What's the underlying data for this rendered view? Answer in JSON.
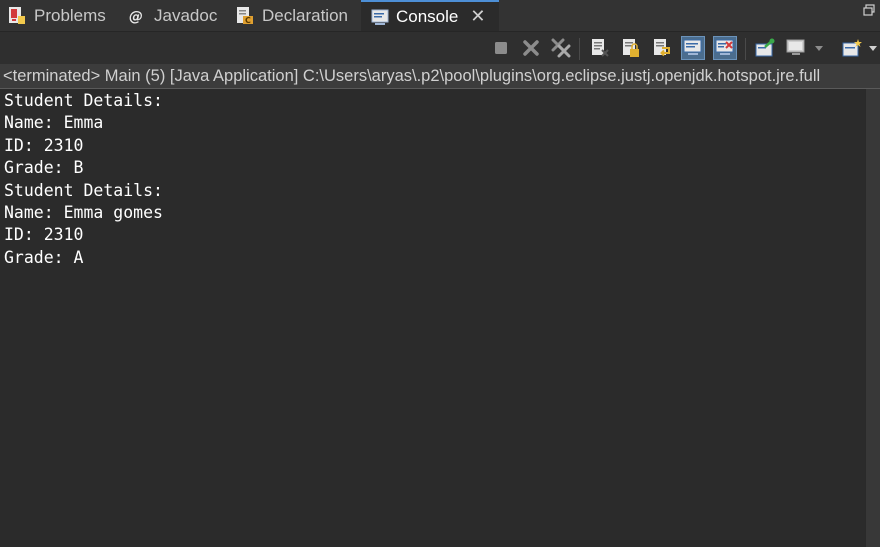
{
  "tabs": [
    {
      "label": "Problems",
      "icon": "problems-icon",
      "active": false
    },
    {
      "label": "Javadoc",
      "icon": "javadoc-icon",
      "active": false
    },
    {
      "label": "Declaration",
      "icon": "declaration-icon",
      "active": false
    },
    {
      "label": "Console",
      "icon": "console-icon",
      "active": true
    }
  ],
  "console": {
    "status_line": "<terminated> Main (5) [Java Application] C:\\Users\\aryas\\.p2\\pool\\plugins\\org.eclipse.justj.openjdk.hotspot.jre.full",
    "lines": [
      "Student Details:",
      "Name: Emma",
      "ID: 2310",
      "Grade: B",
      "Student Details:",
      "Name: Emma gomes",
      "ID: 2310",
      "Grade: A"
    ]
  },
  "toolbar": {
    "icons": [
      "terminate-icon",
      "remove-launch-icon",
      "remove-all-terminated-icon",
      "clear-console-icon",
      "scroll-lock-icon",
      "word-wrap-icon",
      "show-on-stdout-icon",
      "show-on-stderr-icon",
      "pin-console-icon",
      "display-console-icon",
      "display-console-dropdown-icon",
      "open-console-icon"
    ]
  },
  "colors": {
    "background": "#2b2b2b",
    "active_tab_accent": "#4d8fd6",
    "text": "#ffffff"
  }
}
